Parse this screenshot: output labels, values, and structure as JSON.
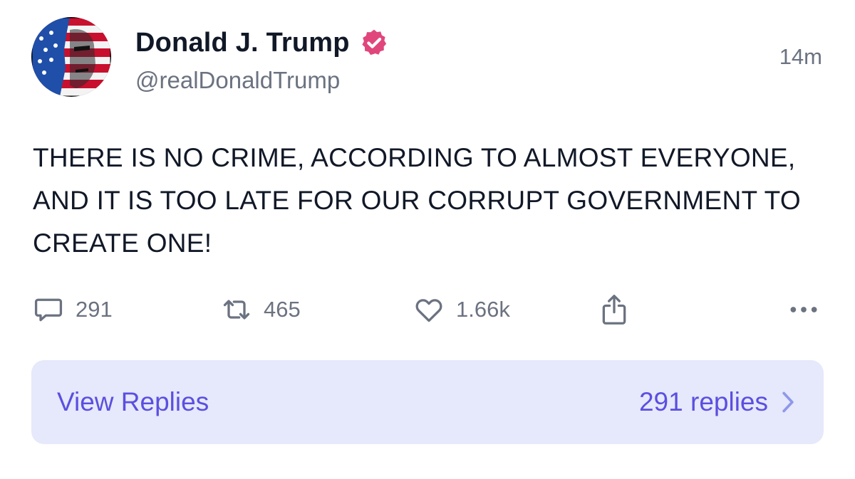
{
  "post": {
    "author": {
      "display_name": "Donald J. Trump",
      "handle": "@realDonaldTrump",
      "verified": true,
      "verified_icon": "verified-badge-icon",
      "verified_color": "#e0467c",
      "avatar_icon": "flag-portrait-avatar"
    },
    "timestamp": "14m",
    "text": "THERE IS NO CRIME, ACCORDING TO ALMOST EVERYONE, AND IT IS TOO LATE FOR OUR CORRUPT GOVERNMENT TO CREATE ONE!"
  },
  "actions": {
    "reply": {
      "icon": "reply-bubble-icon",
      "count": "291"
    },
    "repost": {
      "icon": "repost-icon",
      "count": "465"
    },
    "like": {
      "icon": "heart-icon",
      "count": "1.66k"
    },
    "share": {
      "icon": "share-icon"
    },
    "more": {
      "icon": "more-dots-icon"
    }
  },
  "replies_bar": {
    "label": "View Replies",
    "count_label": "291 replies",
    "icon": "chevron-right-icon",
    "accent_color": "#5b4fe0",
    "background_color": "#e6e8fb"
  },
  "colors": {
    "text_primary": "#111827",
    "text_secondary": "#6b7280"
  }
}
